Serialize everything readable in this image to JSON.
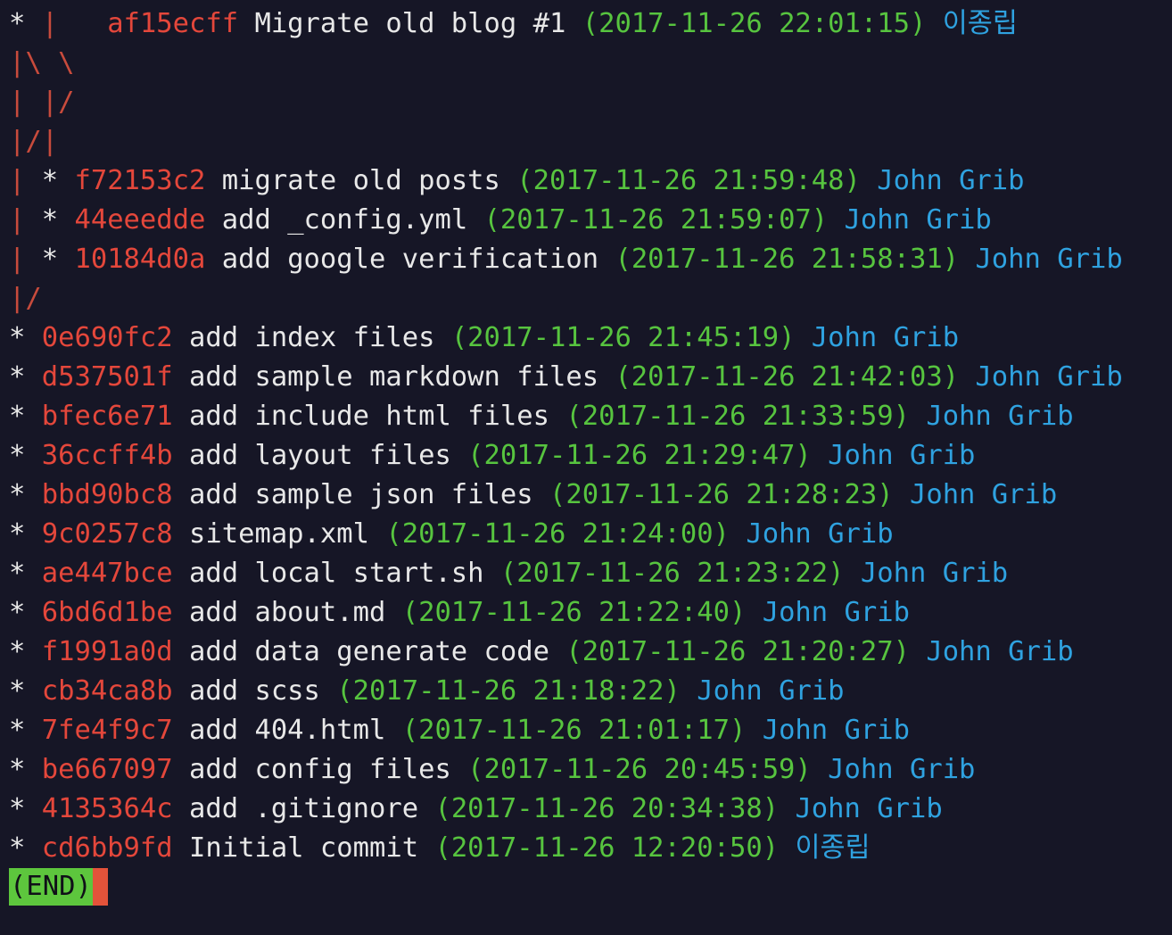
{
  "colors": {
    "background": "#161626",
    "hash": "#e4473b",
    "date": "#57c43f",
    "author": "#2fa2e0",
    "graph": "#c84b3c",
    "end_bg": "#5dc63d",
    "cursor": "#e4533a"
  },
  "log": [
    {
      "g1": "* ",
      "g2": "|   ",
      "hash": "af15ecff",
      "msg": " Migrate old blog #1 ",
      "date": "(2017-11-26 22:01:15)",
      "author": " 이종립"
    },
    {
      "g1": "",
      "g2": "|\\ \\",
      "hash": "",
      "msg": "",
      "date": "",
      "author": ""
    },
    {
      "g1": "",
      "g2": "| |/",
      "hash": "",
      "msg": "",
      "date": "",
      "author": ""
    },
    {
      "g1": "",
      "g2": "|/|",
      "hash": "",
      "msg": "",
      "date": "",
      "author": ""
    },
    {
      "g1": "",
      "g2": "| ",
      "star": "* ",
      "hash": "f72153c2",
      "msg": " migrate old posts ",
      "date": "(2017-11-26 21:59:48)",
      "author": " John Grib"
    },
    {
      "g1": "",
      "g2": "| ",
      "star": "* ",
      "hash": "44eeedde",
      "msg": " add _config.yml ",
      "date": "(2017-11-26 21:59:07)",
      "author": " John Grib"
    },
    {
      "g1": "",
      "g2": "| ",
      "star": "* ",
      "hash": "10184d0a",
      "msg": " add google verification ",
      "date": "(2017-11-26 21:58:31)",
      "author": " John Grib"
    },
    {
      "g1": "",
      "g2": "|/",
      "hash": "",
      "msg": "",
      "date": "",
      "author": ""
    },
    {
      "g1": "* ",
      "g2": "",
      "hash": "0e690fc2",
      "msg": " add index files ",
      "date": "(2017-11-26 21:45:19)",
      "author": " John Grib"
    },
    {
      "g1": "* ",
      "g2": "",
      "hash": "d537501f",
      "msg": " add sample markdown files ",
      "date": "(2017-11-26 21:42:03)",
      "author": " John Grib"
    },
    {
      "g1": "* ",
      "g2": "",
      "hash": "bfec6e71",
      "msg": " add include html files ",
      "date": "(2017-11-26 21:33:59)",
      "author": " John Grib"
    },
    {
      "g1": "* ",
      "g2": "",
      "hash": "36ccff4b",
      "msg": " add layout files ",
      "date": "(2017-11-26 21:29:47)",
      "author": " John Grib"
    },
    {
      "g1": "* ",
      "g2": "",
      "hash": "bbd90bc8",
      "msg": " add sample json files ",
      "date": "(2017-11-26 21:28:23)",
      "author": " John Grib"
    },
    {
      "g1": "* ",
      "g2": "",
      "hash": "9c0257c8",
      "msg": " sitemap.xml ",
      "date": "(2017-11-26 21:24:00)",
      "author": " John Grib"
    },
    {
      "g1": "* ",
      "g2": "",
      "hash": "ae447bce",
      "msg": " add local start.sh ",
      "date": "(2017-11-26 21:23:22)",
      "author": " John Grib"
    },
    {
      "g1": "* ",
      "g2": "",
      "hash": "6bd6d1be",
      "msg": " add about.md ",
      "date": "(2017-11-26 21:22:40)",
      "author": " John Grib"
    },
    {
      "g1": "* ",
      "g2": "",
      "hash": "f1991a0d",
      "msg": " add data generate code ",
      "date": "(2017-11-26 21:20:27)",
      "author": " John Grib"
    },
    {
      "g1": "* ",
      "g2": "",
      "hash": "cb34ca8b",
      "msg": " add scss ",
      "date": "(2017-11-26 21:18:22)",
      "author": " John Grib"
    },
    {
      "g1": "* ",
      "g2": "",
      "hash": "7fe4f9c7",
      "msg": " add 404.html ",
      "date": "(2017-11-26 21:01:17)",
      "author": " John Grib"
    },
    {
      "g1": "* ",
      "g2": "",
      "hash": "be667097",
      "msg": " add config files ",
      "date": "(2017-11-26 20:45:59)",
      "author": " John Grib"
    },
    {
      "g1": "* ",
      "g2": "",
      "hash": "4135364c",
      "msg": " add .gitignore ",
      "date": "(2017-11-26 20:34:38)",
      "author": " John Grib"
    },
    {
      "g1": "* ",
      "g2": "",
      "hash": "cd6bb9fd",
      "msg": " Initial commit ",
      "date": "(2017-11-26 12:20:50)",
      "author": " 이종립"
    }
  ],
  "pager": {
    "end_label": "(END)"
  }
}
